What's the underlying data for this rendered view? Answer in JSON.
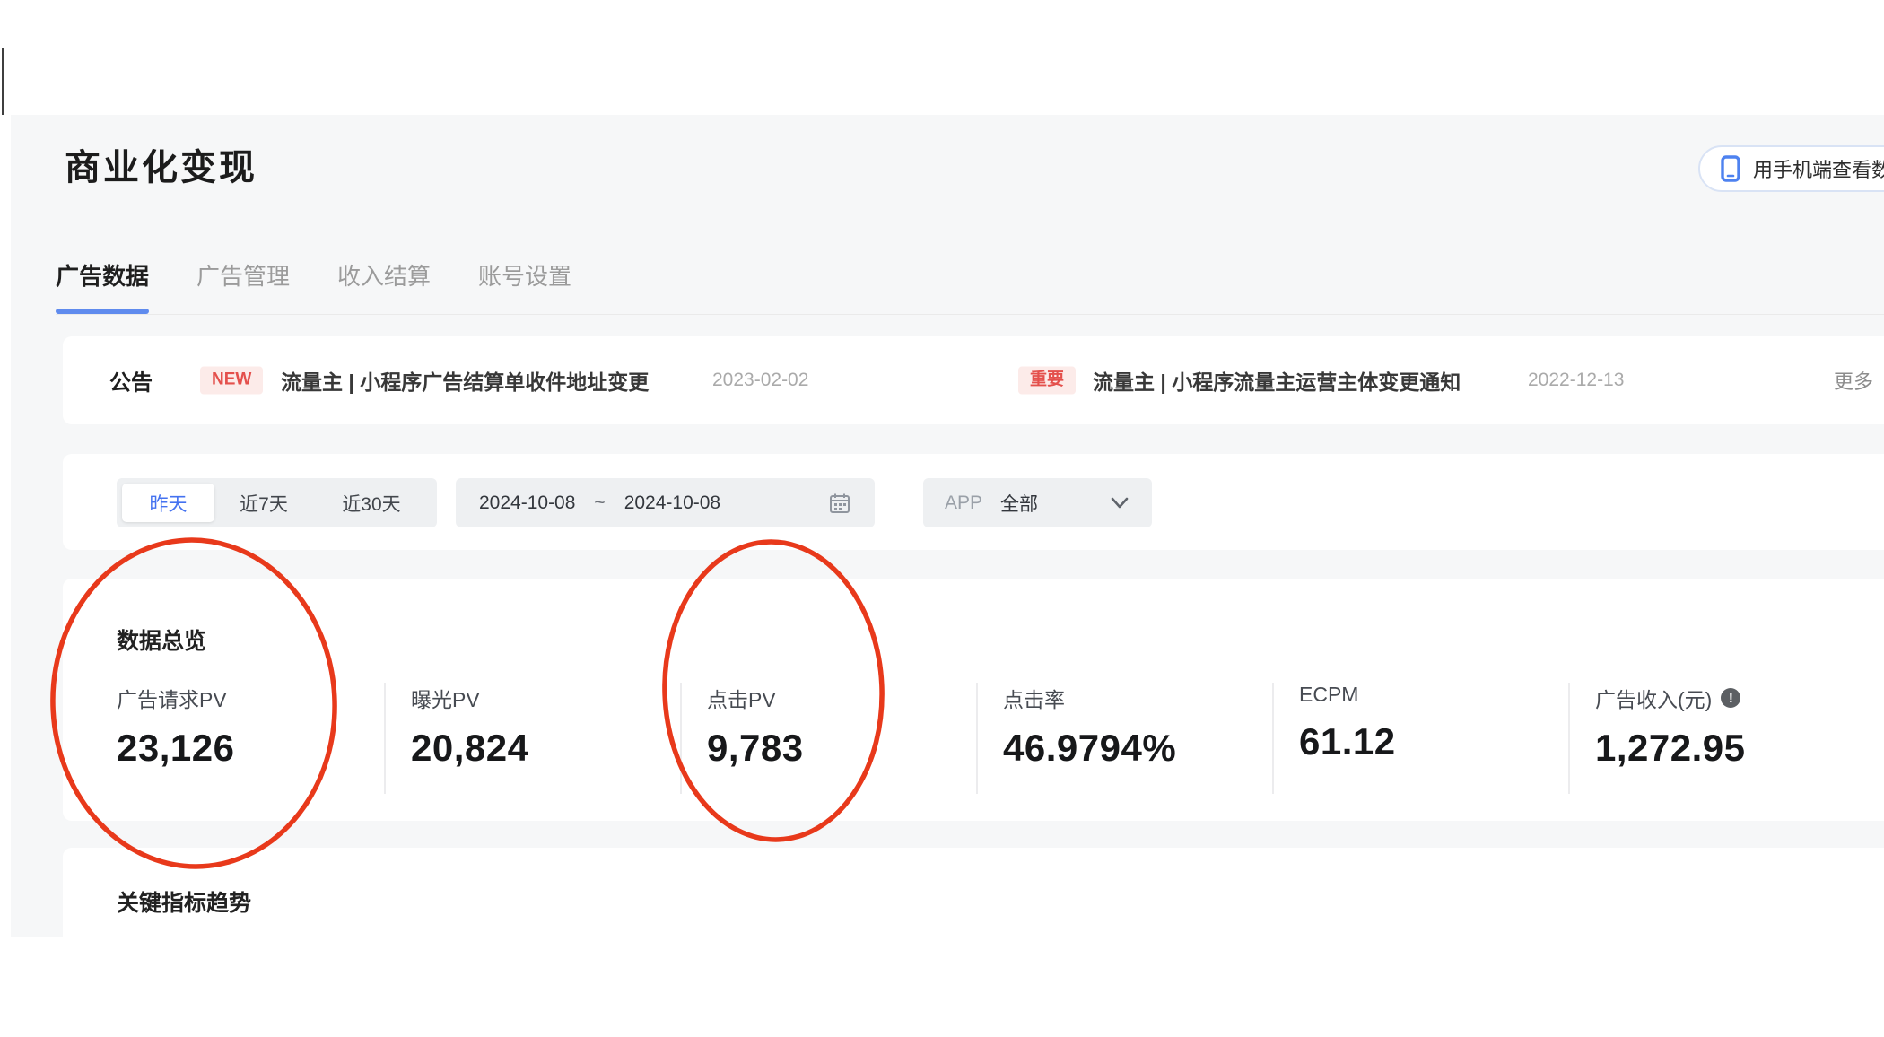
{
  "header": {
    "title": "商业化变现",
    "phone_button_label": "用手机端查看数据"
  },
  "tabs": [
    {
      "label": "广告数据",
      "active": true
    },
    {
      "label": "广告管理",
      "active": false
    },
    {
      "label": "收入结算",
      "active": false
    },
    {
      "label": "账号设置",
      "active": false
    }
  ],
  "announcement": {
    "label": "公告",
    "items": [
      {
        "badge": "NEW",
        "title": "流量主 | 小程序广告结算单收件地址变更",
        "date": "2023-02-02"
      },
      {
        "badge": "重要",
        "title": "流量主 | 小程序流量主运营主体变更通知",
        "date": "2022-12-13"
      }
    ],
    "more": "更多"
  },
  "filters": {
    "quick_ranges": [
      {
        "label": "昨天",
        "active": true
      },
      {
        "label": "近7天",
        "active": false
      },
      {
        "label": "近30天",
        "active": false
      }
    ],
    "date_range": {
      "start": "2024-10-08",
      "separator": "~",
      "end": "2024-10-08"
    },
    "app_select": {
      "label": "APP",
      "value": "全部"
    }
  },
  "overview": {
    "title": "数据总览",
    "metrics": [
      {
        "label": "广告请求PV",
        "value": "23,126"
      },
      {
        "label": "曝光PV",
        "value": "20,824"
      },
      {
        "label": "点击PV",
        "value": "9,783"
      },
      {
        "label": "点击率",
        "value": "46.9794%"
      },
      {
        "label": "ECPM",
        "value": "61.12"
      },
      {
        "label": "广告收入(元)",
        "value": "1,272.95",
        "info_glyph": "!"
      }
    ]
  },
  "trend": {
    "title": "关键指标趋势"
  },
  "annotations": {
    "color": "#e8391b",
    "circled_metrics": [
      "广告请求PV",
      "点击PV"
    ]
  }
}
